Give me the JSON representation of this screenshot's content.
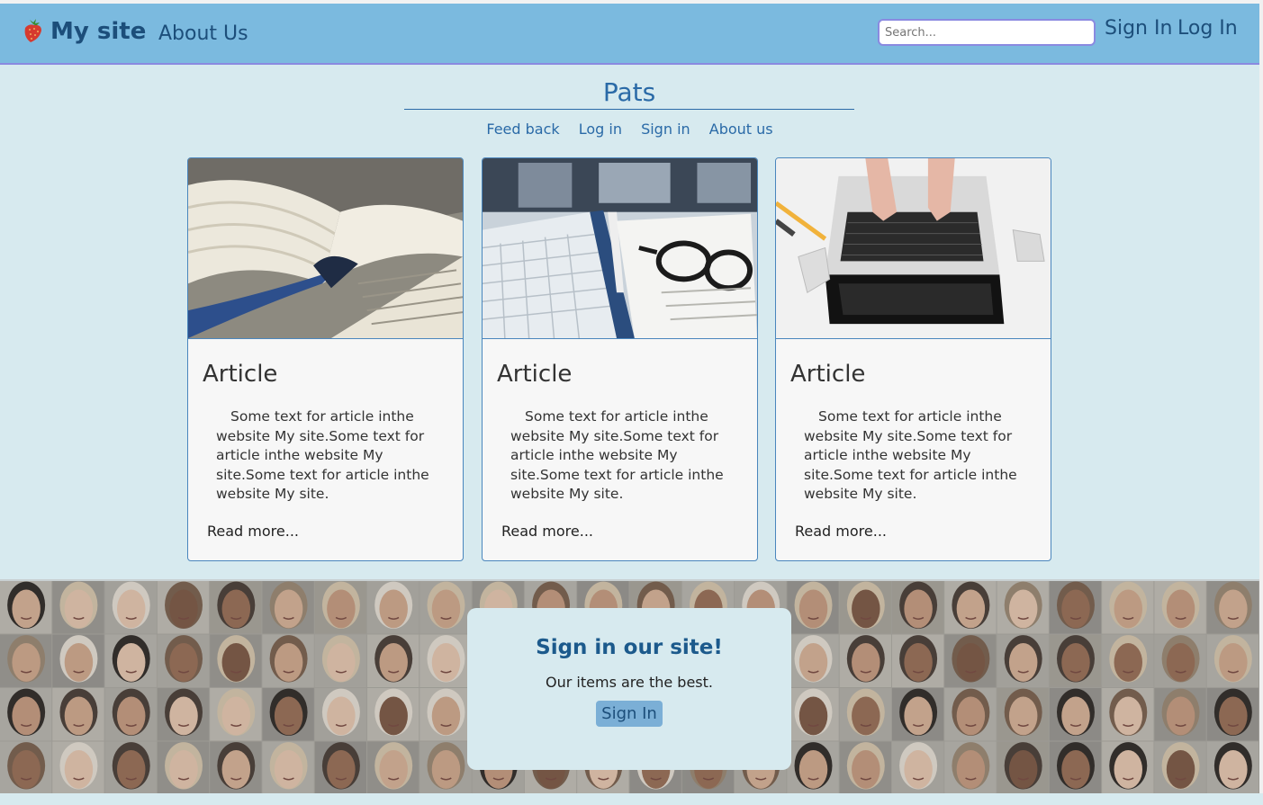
{
  "navbar": {
    "brand": "My site",
    "about": "About Us",
    "search_placeholder": "Search...",
    "sign_in": "Sign In",
    "log_in": "Log In"
  },
  "header": {
    "title": "Pats",
    "links": [
      "Feed back",
      "Log in",
      "Sign in",
      "About us"
    ]
  },
  "cards": [
    {
      "title": "Article",
      "text": "Some text for article inthe website My site.Some text for article inthe website My site.Some text for article inthe website My site.",
      "more": "Read more..."
    },
    {
      "title": "Article",
      "text": "Some text for article inthe website My site.Some text for article inthe website My site.Some text for article inthe website My site.",
      "more": "Read more..."
    },
    {
      "title": "Article",
      "text": "Some text for article inthe website My site.Some text for article inthe website My site.Some text for article inthe website My site.",
      "more": "Read more..."
    }
  ],
  "cta": {
    "title": "Sign in our site!",
    "text": "Our items are the best.",
    "button": "Sign In"
  },
  "colors": {
    "navbar": "#7bbadf",
    "page_bg": "#d7eaef",
    "link": "#2a6aa7",
    "brand": "#1c4e7a"
  }
}
